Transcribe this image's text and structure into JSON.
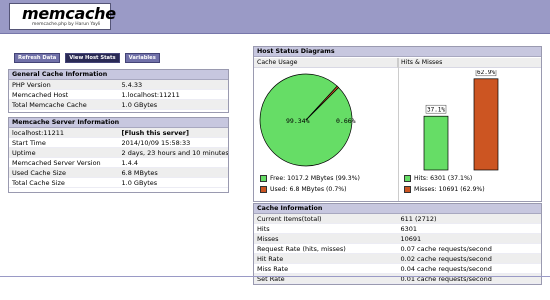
{
  "header": {
    "title": "memcache",
    "subtitle": "memcache.php by Harun Yayli"
  },
  "toolbar": {
    "refresh_label": "Refresh Data",
    "host_stats_label": "View Host Stats",
    "variables_label": "Variables"
  },
  "general": {
    "title": "General Cache Information",
    "rows": [
      {
        "k": "PHP Version",
        "v": "5.4.33"
      },
      {
        "k": "Memcached Host",
        "v": "1.localhost:11211"
      },
      {
        "k": "Total Memcache Cache",
        "v": "1.0 GBytes"
      }
    ]
  },
  "server": {
    "title": "Memcache Server Information",
    "host": "localhost:11211",
    "flush_label": "[Flush this server]",
    "rows": [
      {
        "k": "Start Time",
        "v": "2014/10/09 15:58:33"
      },
      {
        "k": "Uptime",
        "v": "2 days, 23 hours and 10 minutes"
      },
      {
        "k": "Memcached Server Version",
        "v": "1.4.4"
      },
      {
        "k": "Used Cache Size",
        "v": "6.8 MBytes"
      },
      {
        "k": "Total Cache Size",
        "v": "1.0 GBytes"
      }
    ]
  },
  "diagrams": {
    "title": "Host Status Diagrams",
    "usage_label": "Cache Usage",
    "hits_label": "Hits & Misses",
    "free_legend": "Free: 1017.2 MBytes (99.3%)",
    "used_legend": "Used: 6.8 MBytes (0.7%)",
    "hits_legend": "Hits: 6301 (37.1%)",
    "misses_legend": "Misses: 10691 (62.9%)",
    "colors": {
      "free": "#66dd66",
      "used": "#cc5522",
      "misses": "#cc5522"
    }
  },
  "chart_data": [
    {
      "type": "pie",
      "title": "Cache Usage",
      "categories": [
        "Free",
        "Used"
      ],
      "values": [
        99.34,
        0.66
      ],
      "labels": [
        "99.34%",
        "0.66%"
      ]
    },
    {
      "type": "bar",
      "title": "Hits & Misses",
      "categories": [
        "Hits",
        "Misses"
      ],
      "values": [
        37.1,
        62.9
      ],
      "labels": [
        "37.1%",
        "62.9%"
      ],
      "ylim": [
        0,
        100
      ]
    }
  ],
  "cache": {
    "title": "Cache Information",
    "rows": [
      {
        "k": "Current Items(total)",
        "v": "611 (2712)"
      },
      {
        "k": "Hits",
        "v": "6301"
      },
      {
        "k": "Misses",
        "v": "10691"
      },
      {
        "k": "Request Rate (hits, misses)",
        "v": "0.07 cache requests/second"
      },
      {
        "k": "Hit Rate",
        "v": "0.02 cache requests/second"
      },
      {
        "k": "Miss Rate",
        "v": "0.04 cache requests/second"
      },
      {
        "k": "Set Rate",
        "v": "0.01 cache requests/second"
      }
    ]
  }
}
